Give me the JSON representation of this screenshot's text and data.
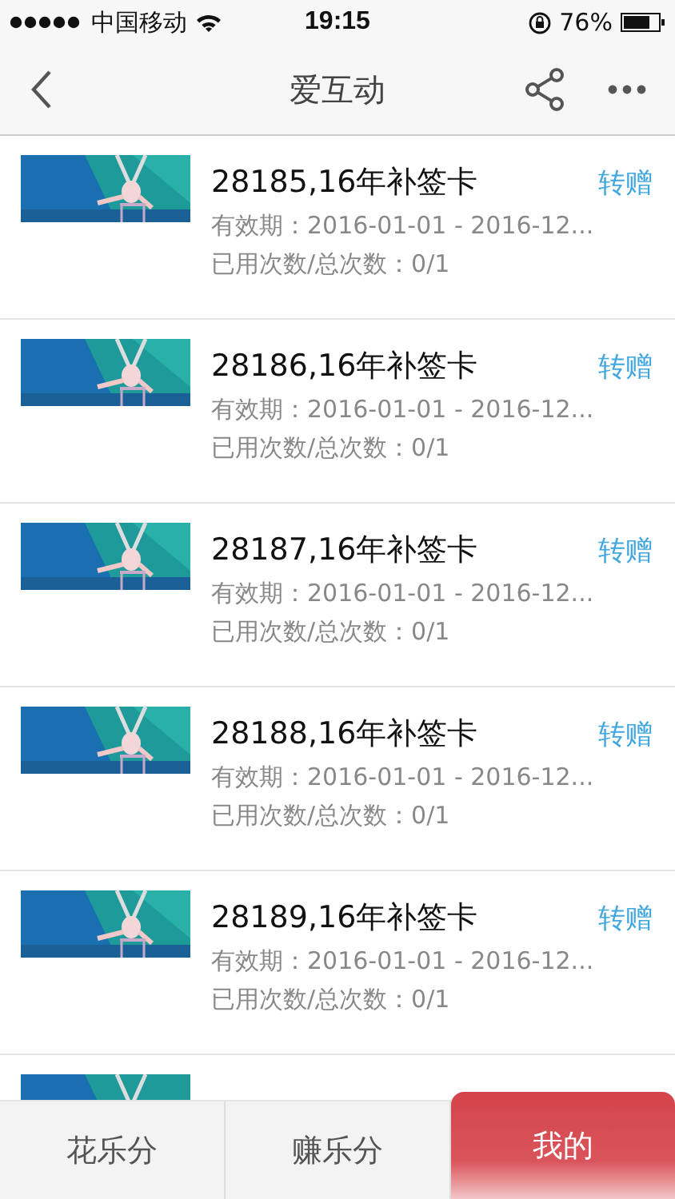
{
  "status_bar": {
    "carrier": "中国移动",
    "time": "19:15",
    "battery_percent": "76%"
  },
  "nav_bar": {
    "title": "爱互动"
  },
  "cards": [
    {
      "title": "28185,16年补签卡",
      "action": "转赠",
      "validity": "有效期：2016-01-01 - 2016-12...",
      "usage": "已用次数/总次数：0/1"
    },
    {
      "title": "28186,16年补签卡",
      "action": "转赠",
      "validity": "有效期：2016-01-01 - 2016-12...",
      "usage": "已用次数/总次数：0/1"
    },
    {
      "title": "28187,16年补签卡",
      "action": "转赠",
      "validity": "有效期：2016-01-01 - 2016-12...",
      "usage": "已用次数/总次数：0/1"
    },
    {
      "title": "28188,16年补签卡",
      "action": "转赠",
      "validity": "有效期：2016-01-01 - 2016-12...",
      "usage": "已用次数/总次数：0/1"
    },
    {
      "title": "28189,16年补签卡",
      "action": "转赠",
      "validity": "有效期：2016-01-01 - 2016-12...",
      "usage": "已用次数/总次数：0/1"
    }
  ],
  "tab_bar": [
    {
      "label": "花乐分",
      "selected": false
    },
    {
      "label": "赚乐分",
      "selected": false
    },
    {
      "label": "我的",
      "selected": true
    }
  ]
}
